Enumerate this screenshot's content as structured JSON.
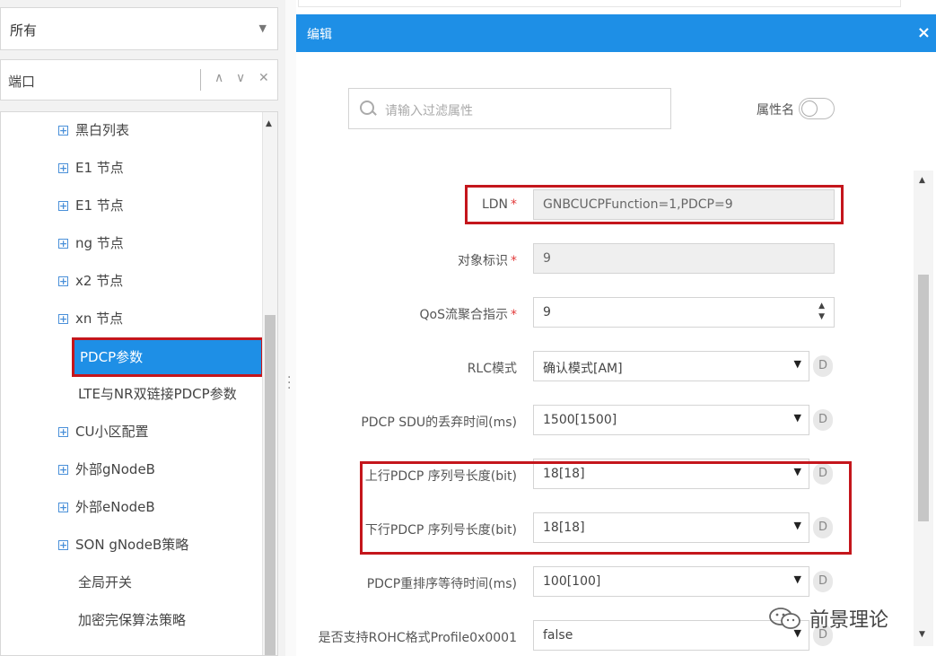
{
  "left_panel": {
    "scope_select": {
      "value": "所有"
    },
    "search": {
      "value": "端口"
    },
    "tree_items": [
      {
        "label": "黑白列表",
        "expandable": true,
        "indent": 1
      },
      {
        "label": "E1 节点",
        "expandable": true,
        "indent": 1
      },
      {
        "label": "E1 节点",
        "expandable": true,
        "indent": 1
      },
      {
        "label": "ng 节点",
        "expandable": true,
        "indent": 1
      },
      {
        "label": "x2 节点",
        "expandable": true,
        "indent": 1
      },
      {
        "label": "xn 节点",
        "expandable": true,
        "indent": 1
      },
      {
        "label": "PDCP参数",
        "expandable": false,
        "indent": 2,
        "selected": true
      },
      {
        "label": "LTE与NR双链接PDCP参数",
        "expandable": false,
        "indent": 2
      },
      {
        "label": "CU小区配置",
        "expandable": true,
        "indent": 1
      },
      {
        "label": "外部gNodeB",
        "expandable": true,
        "indent": 1
      },
      {
        "label": "外部eNodeB",
        "expandable": true,
        "indent": 1
      },
      {
        "label": "SON gNodeB策略",
        "expandable": true,
        "indent": 1
      },
      {
        "label": "全局开关",
        "expandable": false,
        "indent": 2
      },
      {
        "label": "加密完保算法策略",
        "expandable": false,
        "indent": 2
      }
    ]
  },
  "dialog": {
    "title": "编辑",
    "close_label": "×",
    "filter": {
      "placeholder": "请输入过滤属性"
    },
    "toggle_label": "属性名",
    "fields": [
      {
        "label": "LDN",
        "required": true,
        "value": "GNBCUCPFunction=1,PDCP=9",
        "kind": "readonly",
        "highlighted": true
      },
      {
        "label": "对象标识",
        "required": true,
        "value": "9",
        "kind": "readonly"
      },
      {
        "label": "QoS流聚合指示",
        "required": true,
        "value": "9",
        "kind": "spinner"
      },
      {
        "label": "RLC模式",
        "required": false,
        "value": "确认模式[AM]",
        "kind": "select",
        "default_btn": "D"
      },
      {
        "label": "PDCP SDU的丢弃时间(ms)",
        "required": false,
        "value": "1500[1500]",
        "kind": "select",
        "default_btn": "D"
      },
      {
        "label": "上行PDCP 序列号长度(bit)",
        "required": false,
        "value": "18[18]",
        "kind": "select",
        "default_btn": "D",
        "highlighted": true
      },
      {
        "label": "下行PDCP 序列号长度(bit)",
        "required": false,
        "value": "18[18]",
        "kind": "select",
        "default_btn": "D",
        "highlighted": true
      },
      {
        "label": "PDCP重排序等待时间(ms)",
        "required": false,
        "value": "100[100]",
        "kind": "select",
        "default_btn": "D"
      },
      {
        "label": "是否支持ROHC格式Profile0x0001",
        "required": false,
        "value": "false",
        "kind": "select",
        "default_btn": "D"
      }
    ]
  },
  "watermark": {
    "text": "前景理论"
  },
  "colors": {
    "accent": "#1e8fe6",
    "highlight": "#c4161c",
    "required": "#e23a3a"
  }
}
